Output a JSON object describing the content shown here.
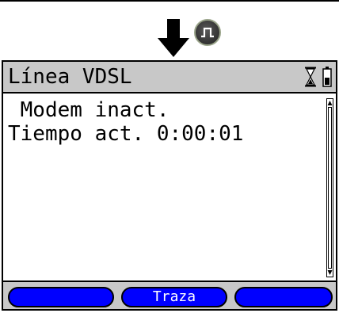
{
  "header": {
    "arrow_icon": "down-arrow-icon",
    "key_icon": "signal-pulse-key-icon"
  },
  "screen": {
    "title": "Línea VDSL",
    "status_icons": [
      "hourglass-icon",
      "battery-icon"
    ],
    "lines": [
      " Modem inact.",
      "Tiempo act. 0:00:01"
    ]
  },
  "softkeys": {
    "left": "",
    "middle": "Traza",
    "right": ""
  },
  "colors": {
    "title_bar": "#c8c8c8",
    "softkey": "#0000ff",
    "softkey_text": "#ffffff"
  }
}
